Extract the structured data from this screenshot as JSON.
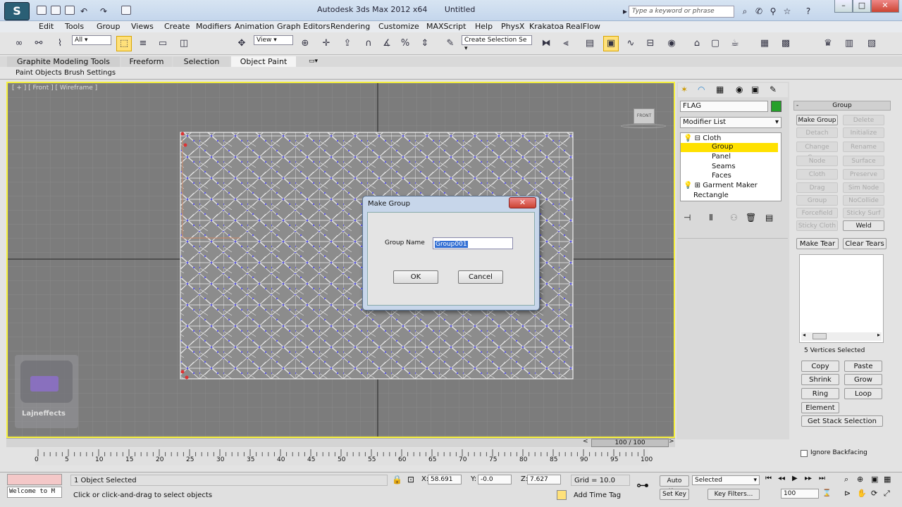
{
  "titlebar": {
    "app": "Autodesk 3ds Max  2012 x64",
    "doc": "Untitled",
    "search_placeholder": "Type a keyword or phrase"
  },
  "menu": [
    "Edit",
    "Tools",
    "Group",
    "Views",
    "Create",
    "Modifiers",
    "Animation",
    "Graph Editors",
    "Rendering",
    "Customize",
    "MAXScript",
    "Help",
    "PhysX",
    "Krakatoa",
    "RealFlow"
  ],
  "toolbar": {
    "filter": "All",
    "ref_coord": "View",
    "named_sel": "Create Selection Se"
  },
  "ribbon": {
    "tabs": [
      "Graphite Modeling Tools",
      "Freeform",
      "Selection",
      "Object Paint"
    ],
    "subtabs": [
      "Paint Objects",
      "Brush Settings"
    ]
  },
  "viewport": {
    "label": "[ + ] [ Front ] [ Wireframe ]",
    "cube": "FRONT",
    "watermark": "Lajneffects"
  },
  "command_panel": {
    "object_name": "FLAG",
    "modifier_list": "Modifier List",
    "stack": [
      {
        "label": "Cloth",
        "level": 0
      },
      {
        "label": "Group",
        "level": 1,
        "selected": true
      },
      {
        "label": "Panel",
        "level": 1
      },
      {
        "label": "Seams",
        "level": 1
      },
      {
        "label": "Faces",
        "level": 1
      },
      {
        "label": "Garment Maker",
        "level": 0
      },
      {
        "label": "Rectangle",
        "level": 0
      }
    ]
  },
  "group_panel": {
    "header": "Group",
    "buttons": [
      [
        "Make Group",
        "Delete Group"
      ],
      [
        "Detach",
        "Initialize"
      ],
      [
        "Change Group",
        "Rename"
      ],
      [
        "Node",
        "Surface"
      ],
      [
        "Cloth",
        "Preserve"
      ],
      [
        "Drag",
        "Sim Node"
      ],
      [
        "Group",
        "NoCollide"
      ],
      [
        "Forcefield",
        "Sticky Surf"
      ],
      [
        "Sticky Cloth",
        "Weld"
      ]
    ],
    "tear": [
      "Make Tear",
      "Clear Tears"
    ],
    "vertices_selected": "5 Vertices Selected",
    "sel_buttons": [
      [
        "Copy",
        "Paste"
      ],
      [
        "Shrink",
        "Grow"
      ],
      [
        "Ring",
        "Loop"
      ]
    ],
    "element": "Element",
    "get_stack": "Get Stack Selection",
    "ignore_backfacing": "Ignore Backfacing"
  },
  "dialog": {
    "title": "Make Group",
    "field_label": "Group Name",
    "field_value": "Group001",
    "ok": "OK",
    "cancel": "Cancel"
  },
  "timeline": {
    "frame": "100 / 100",
    "ticks": [
      "0",
      "5",
      "10",
      "15",
      "20",
      "25",
      "30",
      "35",
      "40",
      "45",
      "50",
      "55",
      "60",
      "65",
      "70",
      "75",
      "80",
      "85",
      "90",
      "95",
      "100"
    ]
  },
  "status": {
    "maxscript": "Welcome to M",
    "objects": "1 Object Selected",
    "prompt": "Click or click-and-drag to select objects",
    "x_label": "X:",
    "x": "58.691",
    "y_label": "Y:",
    "y": "-0.0",
    "z_label": "Z:",
    "z": "7.627",
    "grid": "Grid = 10.0",
    "autokey": "Auto Key",
    "setkey": "Set Key",
    "selected": "Selected",
    "keyfilters": "Key Filters...",
    "addtimetag": "Add Time Tag",
    "frame_field": "100"
  }
}
